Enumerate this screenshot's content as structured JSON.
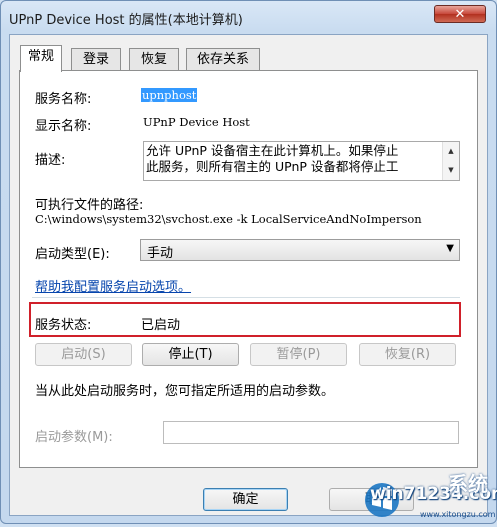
{
  "window": {
    "title": "UPnP Device Host 的属性(本地计算机)",
    "close_label": "✕"
  },
  "tabs": [
    {
      "label": "常规",
      "active": true
    },
    {
      "label": "登录",
      "active": false
    },
    {
      "label": "恢复",
      "active": false
    },
    {
      "label": "依存关系",
      "active": false
    }
  ],
  "general": {
    "service_name_label": "服务名称:",
    "service_name_value": "upnphost",
    "display_name_label": "显示名称:",
    "display_name_value": "UPnP Device Host",
    "description_label": "描述:",
    "description_line1": "允许 UPnP 设备宿主在此计算机上。如果停止",
    "description_line2": "此服务，则所有宿主的 UPnP 设备都将停止工",
    "exe_path_label": "可执行文件的路径:",
    "exe_path_value": "C:\\windows\\system32\\svchost.exe -k LocalServiceAndNoImperson",
    "startup_type_label": "启动类型(E):",
    "startup_type_value": "手动",
    "help_link": "帮助我配置服务启动选项。",
    "status_label": "服务状态:",
    "status_value": "已启动",
    "buttons": {
      "start": "启动(S)",
      "stop": "停止(T)",
      "pause": "暂停(P)",
      "resume": "恢复(R)"
    },
    "hint": "当从此处启动服务时，您可指定所适用的启动参数。",
    "params_label": "启动参数(M):",
    "params_value": ""
  },
  "footer": {
    "ok": "确定",
    "cancel": "取"
  },
  "watermark": {
    "text": "win71234.com",
    "suffix": "系统",
    "url": "www.xitongzu.com"
  }
}
